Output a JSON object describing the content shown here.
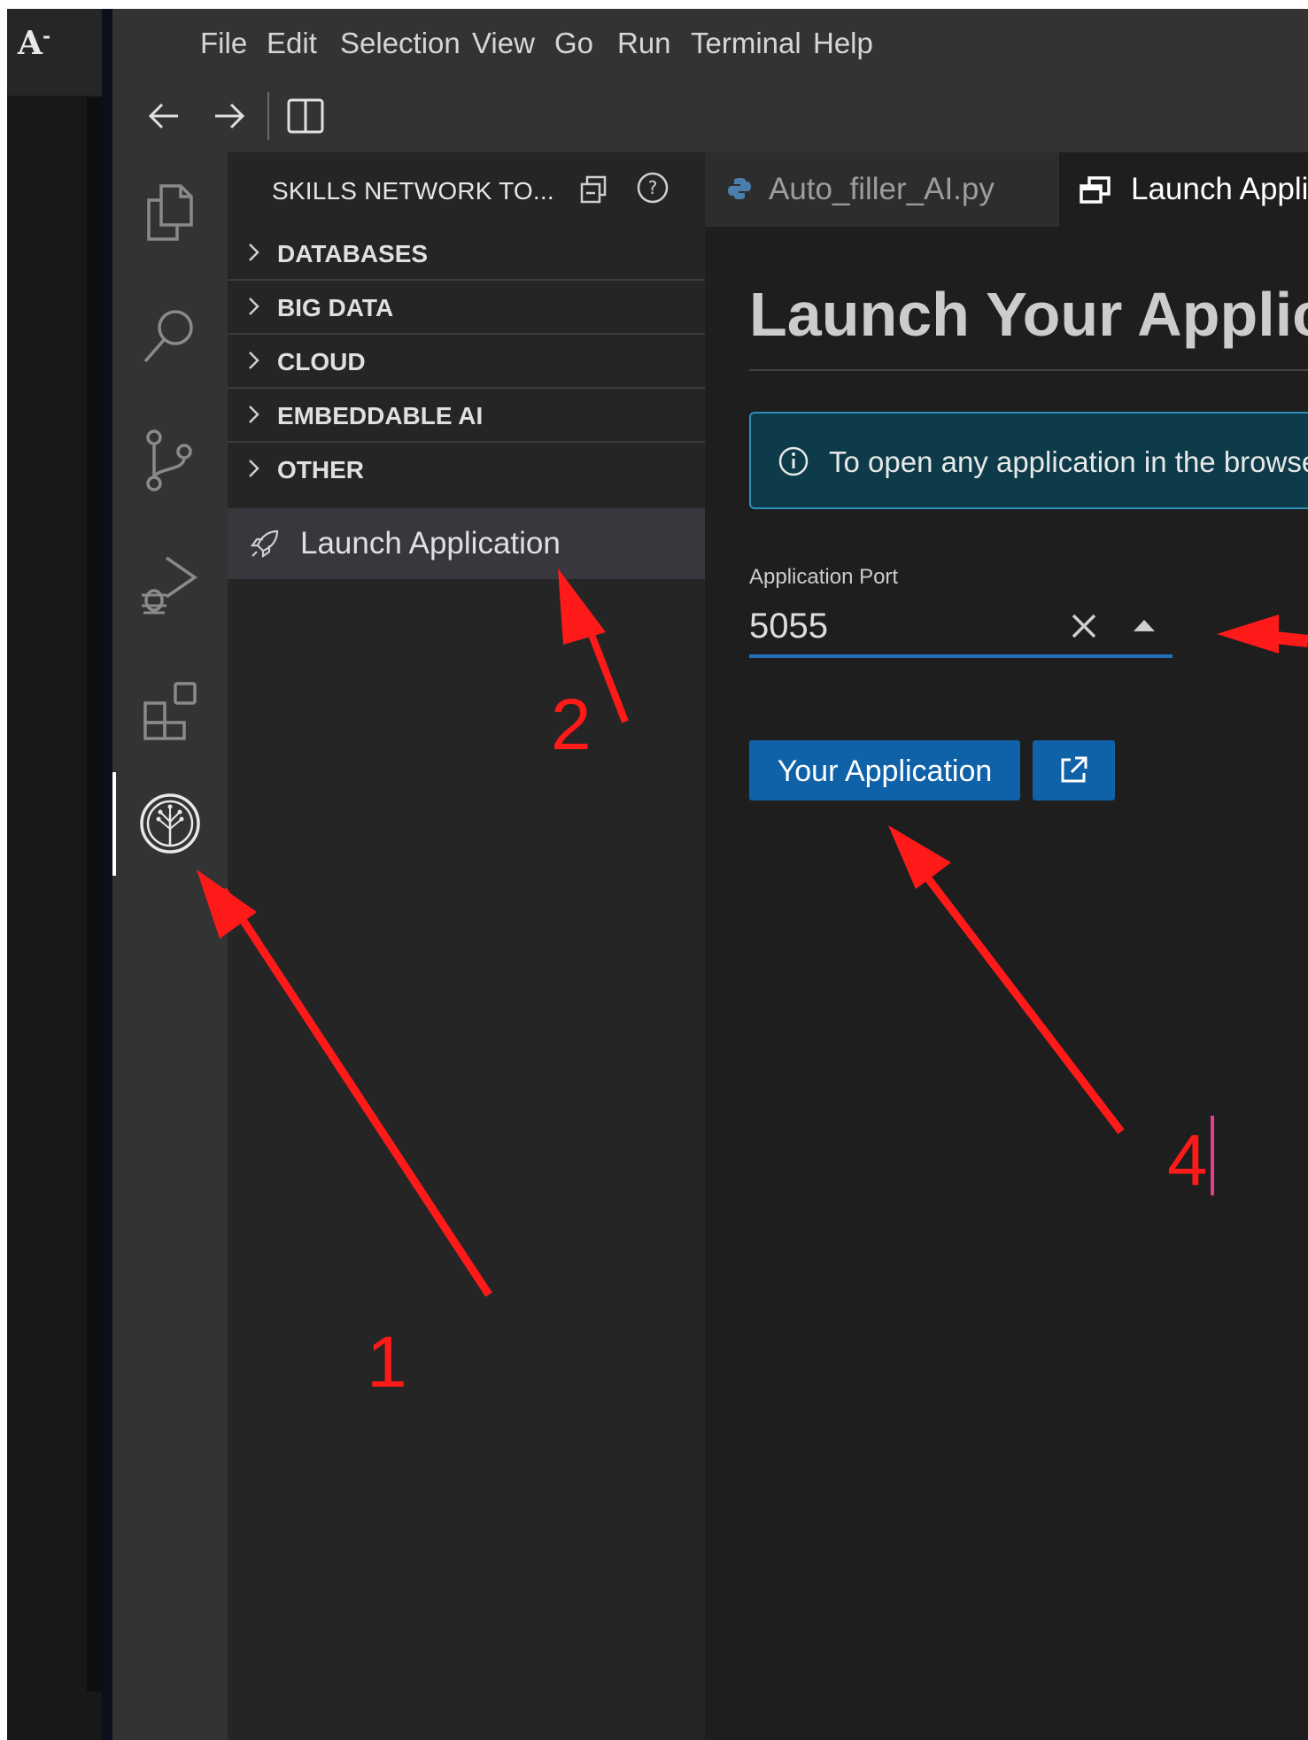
{
  "outer": {
    "logo": "A",
    "logo_sup": "-"
  },
  "menubar": {
    "items": [
      "File",
      "Edit",
      "Selection",
      "View",
      "Go",
      "Run",
      "Terminal",
      "Help"
    ]
  },
  "toolbar": {
    "icons": [
      "arrow-left-icon",
      "arrow-right-icon",
      "split-editor-icon"
    ]
  },
  "activitybar": {
    "icons": [
      "explorer-icon",
      "search-icon",
      "source-control-icon",
      "run-debug-icon",
      "extensions-icon",
      "skills-network-icon"
    ],
    "active": "skills-network-icon"
  },
  "sidebar": {
    "title": "SKILLS NETWORK TO...",
    "sections": [
      "DATABASES",
      "BIG DATA",
      "CLOUD",
      "EMBEDDABLE AI",
      "OTHER"
    ],
    "launch_item": "Launch Application"
  },
  "tabs": [
    {
      "label": "Auto_filler_AI.py",
      "icon": "python-icon",
      "active": false
    },
    {
      "label": "Launch Application",
      "icon": "launch-app-icon",
      "active": true
    }
  ],
  "main": {
    "title": "Launch Your Application",
    "notice": "To open any application in the browser",
    "port_label": "Application Port",
    "port_value": "5055",
    "open_button": "Your Application"
  },
  "annotations": [
    "1",
    "2",
    "4"
  ],
  "colors": {
    "accent_blue": "#0f62a8",
    "annotation_red": "#ff1a1a",
    "notice_bg": "#0d3b4a",
    "notice_border": "#2f8fb8"
  }
}
